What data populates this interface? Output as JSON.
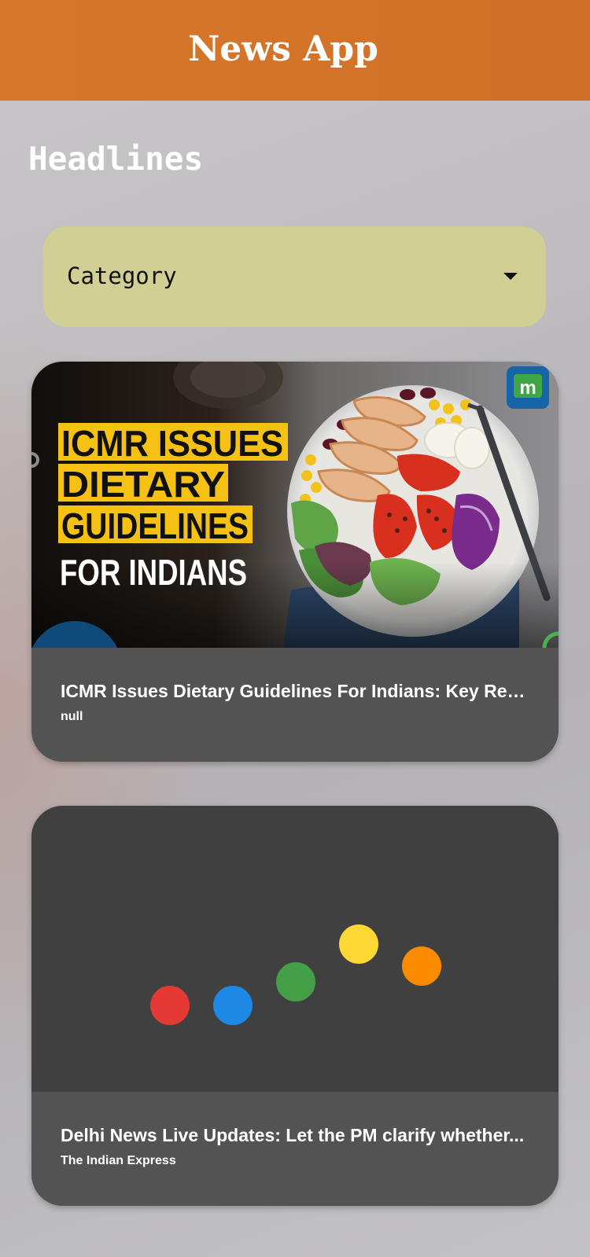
{
  "app_bar": {
    "title": "News App"
  },
  "headlines": {
    "title": "Headlines"
  },
  "category": {
    "selected": "Category"
  },
  "articles": [
    {
      "image_text": [
        "ICMR ISSUES",
        "DIETARY",
        "GUIDELINES",
        "FOR INDIANS"
      ],
      "logo_letter": "m",
      "headline": "ICMR Issues Dietary Guidelines For Indians: Key Rec...",
      "source": "null"
    },
    {
      "headline": "Delhi News Live Updates: Let the PM clarify whether...",
      "source": "The Indian Express"
    }
  ],
  "colors": {
    "app_bar": "#d6782b",
    "dropdown": "#d1cf94",
    "card": "#535353",
    "loading_bg": "#404040",
    "dot_red": "#e53935",
    "dot_blue": "#1e88e5",
    "dot_green": "#43a047",
    "dot_yellow": "#fdd835",
    "dot_orange": "#fb8c00"
  }
}
